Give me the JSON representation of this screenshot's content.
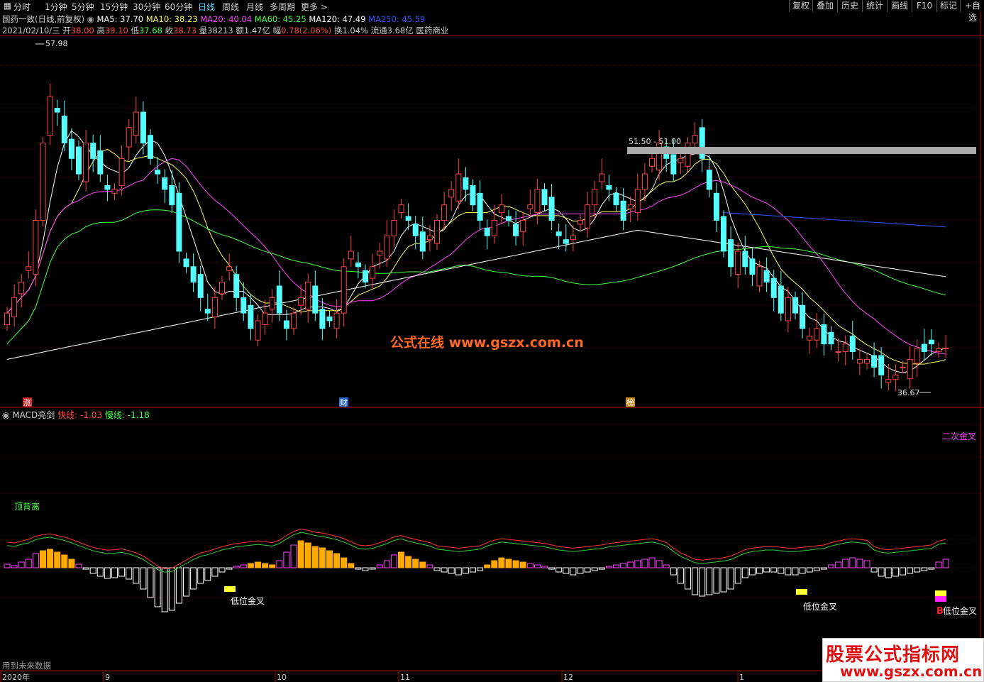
{
  "toolbar": {
    "menu_icon": "window-icon",
    "periods": [
      "分时",
      "1分钟",
      "5分钟",
      "15分钟",
      "30分钟",
      "60分钟",
      "日线",
      "周线",
      "月线",
      "多周期",
      "更多 >"
    ],
    "active_period": "日线",
    "right_buttons": [
      "复权",
      "叠加",
      "历史",
      "统计",
      "画线",
      "F10",
      "标记",
      "+自选"
    ]
  },
  "header": {
    "stock_name": "国药一致(日线,前复权)",
    "ma": [
      {
        "label": "MA5: 37.70",
        "color": "#ffffff"
      },
      {
        "label": "MA10: 38.23",
        "color": "#ffff66"
      },
      {
        "label": "MA20: 40.04",
        "color": "#ff44ff"
      },
      {
        "label": "MA60: 45.25",
        "color": "#44ff44"
      },
      {
        "label": "MA120: 47.49",
        "color": "#ffffff"
      },
      {
        "label": "MA250: 45.59",
        "color": "#3355ff"
      }
    ],
    "quote_date": "2021/02/10/三",
    "quote": [
      {
        "label": "开",
        "value": "38.00",
        "color": "#ff4444"
      },
      {
        "label": "高",
        "value": "39.10",
        "color": "#ff4444"
      },
      {
        "label": "低",
        "value": "37.68",
        "color": "#44ff44"
      },
      {
        "label": "收",
        "value": "38.73",
        "color": "#ff4444"
      },
      {
        "label": "量",
        "value": "38213",
        "color": "#c8c8c8"
      },
      {
        "label": "额",
        "value": "1.47亿",
        "color": "#c8c8c8"
      },
      {
        "label": "幅",
        "value": "0.78(2.06%)",
        "color": "#ff4444"
      },
      {
        "label": "换",
        "value": "1.04%",
        "color": "#c8c8c8"
      },
      {
        "label": "流通",
        "value": "3.68亿",
        "color": "#c8c8c8"
      },
      {
        "label": "",
        "value": "医药商业",
        "color": "#c8c8c8"
      }
    ]
  },
  "main_chart": {
    "high_label": "57.98",
    "low_label": "36.67",
    "range_label": "51.50 - 51.00",
    "watermark": "公式在线  www.gszx.com.cn",
    "markers": [
      "涨",
      "财",
      "榜"
    ],
    "colors": {
      "up": "#ff4444",
      "down": "#55ffff",
      "ma5": "#ffffff",
      "ma10": "#ffff66",
      "ma20": "#ff44ff",
      "ma60": "#44ff44",
      "ma120": "#ffffff",
      "ma250": "#3355ff"
    }
  },
  "indicator": {
    "title": "MACD亮剑",
    "fast_label": "快线: -1.03",
    "slow_label": "慢线: -1.18",
    "top_divergence": "顶背离",
    "second_cross": "二次金叉",
    "low_cross": "低位金叉",
    "buy_mark": "B"
  },
  "footer": {
    "future_data": "用到未来数据",
    "dates": [
      "2020年",
      "9",
      "10",
      "11",
      "12",
      "1"
    ],
    "logo_text": "股票公式指标网",
    "logo_url": "www.gszx.com.cn"
  }
}
